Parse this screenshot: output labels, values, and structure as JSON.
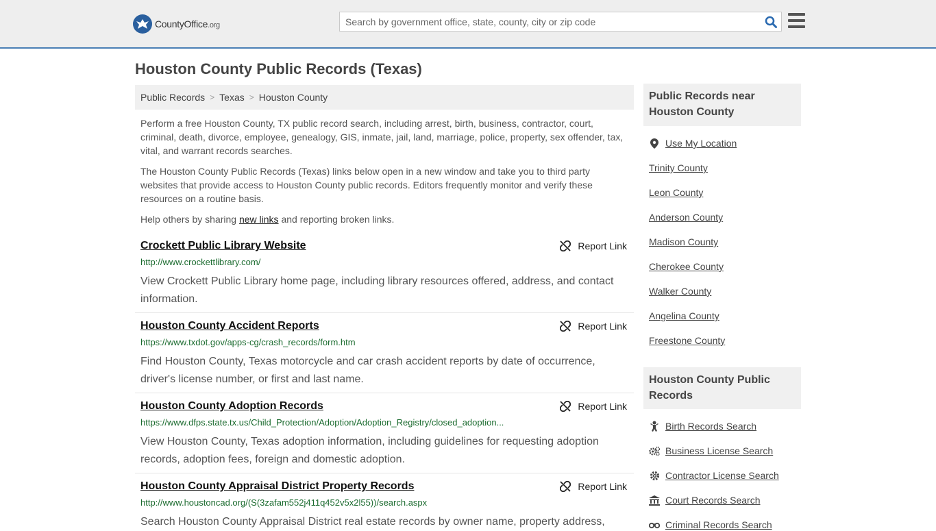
{
  "header": {
    "logo_main": "CountyOffice",
    "logo_org": ".org",
    "search_placeholder": "Search by government office, state, county, city or zip code"
  },
  "page_title": "Houston County Public Records (Texas)",
  "breadcrumb": [
    "Public Records",
    "Texas",
    "Houston County"
  ],
  "intro": {
    "p1": "Perform a free Houston County, TX public record search, including arrest, birth, business, contractor, court, criminal, death, divorce, employee, genealogy, GIS, inmate, jail, land, marriage, police, property, sex offender, tax, vital, and warrant records searches.",
    "p2": "The Houston County Public Records (Texas) links below open in a new window and take you to third party websites that provide access to Houston County public records. Editors frequently monitor and verify these resources on a routine basis.",
    "p3_pre": "Help others by sharing ",
    "p3_link": "new links",
    "p3_post": " and reporting broken links."
  },
  "report_label": "Report Link",
  "records": [
    {
      "title": "Crockett Public Library Website",
      "url": "http://www.crockettlibrary.com/",
      "desc": "View Crockett Public Library home page, including library resources offered, address, and contact information."
    },
    {
      "title": "Houston County Accident Reports",
      "url": "https://www.txdot.gov/apps-cg/crash_records/form.htm",
      "desc": "Find Houston County, Texas motorcycle and car crash accident reports by date of occurrence, driver's license number, or first and last name."
    },
    {
      "title": "Houston County Adoption Records",
      "url": "https://www.dfps.state.tx.us/Child_Protection/Adoption/Adoption_Registry/closed_adoption...",
      "desc": "View Houston County, Texas adoption information, including guidelines for requesting adoption records, adoption fees, foreign and domestic adoption."
    },
    {
      "title": "Houston County Appraisal District Property Records",
      "url": "http://www.houstoncad.org/(S(3zafam552j411q452v5x2l55))/search.aspx",
      "desc": "Search Houston County Appraisal District real estate records by owner name, property address,"
    }
  ],
  "sidebar": {
    "nearby_title": "Public Records near Houston County",
    "use_location": "Use My Location",
    "nearby": [
      "Trinity County",
      "Leon County",
      "Anderson County",
      "Madison County",
      "Cherokee County",
      "Walker County",
      "Angelina County",
      "Freestone County"
    ],
    "records_title": "Houston County Public Records",
    "record_links": [
      {
        "label": "Birth Records Search",
        "icon": "baby-icon"
      },
      {
        "label": "Business License Search",
        "icon": "gears-icon"
      },
      {
        "label": "Contractor License Search",
        "icon": "gear-icon"
      },
      {
        "label": "Court Records Search",
        "icon": "courthouse-icon"
      },
      {
        "label": "Criminal Records Search",
        "icon": "handcuffs-icon"
      }
    ]
  },
  "colors": {
    "accent": "#4a7fb5",
    "url_green": "#1b6b2f",
    "search_blue": "#2a6ab0"
  }
}
